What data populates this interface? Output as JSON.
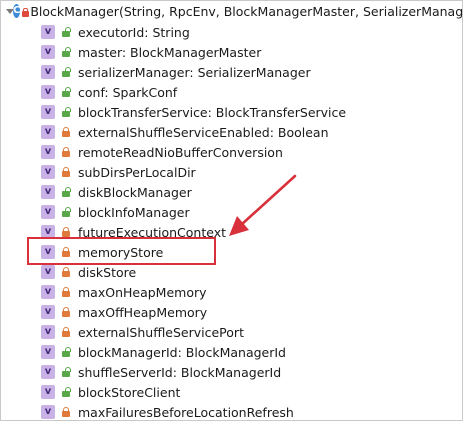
{
  "constructor_node": {
    "icon": "C",
    "label": "BlockManager(String, RpcEnv, BlockManagerMaster, SerializerManag"
  },
  "variable_icon_letter": "v",
  "fields": [
    {
      "label": "executorId: String",
      "access": "open"
    },
    {
      "label": "master: BlockManagerMaster",
      "access": "open"
    },
    {
      "label": "serializerManager: SerializerManager",
      "access": "open"
    },
    {
      "label": "conf: SparkConf",
      "access": "open"
    },
    {
      "label": "blockTransferService: BlockTransferService",
      "access": "open"
    },
    {
      "label": "externalShuffleServiceEnabled: Boolean",
      "access": "closed"
    },
    {
      "label": "remoteReadNioBufferConversion",
      "access": "closed"
    },
    {
      "label": "subDirsPerLocalDir",
      "access": "closed"
    },
    {
      "label": "diskBlockManager",
      "access": "open"
    },
    {
      "label": "blockInfoManager",
      "access": "open"
    },
    {
      "label": "futureExecutionContext",
      "access": "closed"
    },
    {
      "label": "memoryStore",
      "access": "closed"
    },
    {
      "label": "diskStore",
      "access": "closed"
    },
    {
      "label": "maxOnHeapMemory",
      "access": "closed"
    },
    {
      "label": "maxOffHeapMemory",
      "access": "closed"
    },
    {
      "label": "externalShuffleServicePort",
      "access": "closed"
    },
    {
      "label": "blockManagerId: BlockManagerId",
      "access": "open"
    },
    {
      "label": "shuffleServerId: BlockManagerId",
      "access": "open"
    },
    {
      "label": "blockStoreClient",
      "access": "open"
    },
    {
      "label": "maxFailuresBeforeLocationRefresh",
      "access": "closed"
    }
  ],
  "colors": {
    "highlight": "#d9313b",
    "variable_icon_bg": "#c8b2e6",
    "lock_open": "#58a84a",
    "lock_closed": "#e07a3c",
    "class_icon_bg": "#3d8bd6"
  }
}
